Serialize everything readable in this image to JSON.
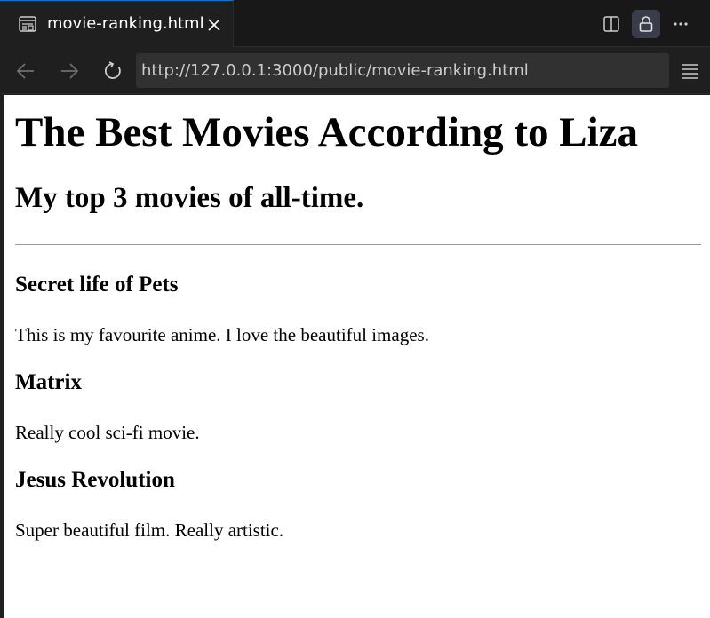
{
  "tab": {
    "title": "movie-ranking.html"
  },
  "navigation": {
    "url": "http://127.0.0.1:3000/public/movie-ranking.html"
  },
  "page": {
    "heading": "The Best Movies According to Liza",
    "subheading": "My top 3 movies of all-time.",
    "movies": [
      {
        "title": "Secret life of Pets",
        "description": "This is my favourite anime. I love the beautiful images."
      },
      {
        "title": "Matrix",
        "description": "Really cool sci-fi movie."
      },
      {
        "title": "Jesus Revolution",
        "description": "Super beautiful film. Really artistic."
      }
    ]
  },
  "colors": {
    "tab_active_border": "#0078d4",
    "chrome_background": "#1f1f1f",
    "lock_button_background": "#3a3d49"
  }
}
